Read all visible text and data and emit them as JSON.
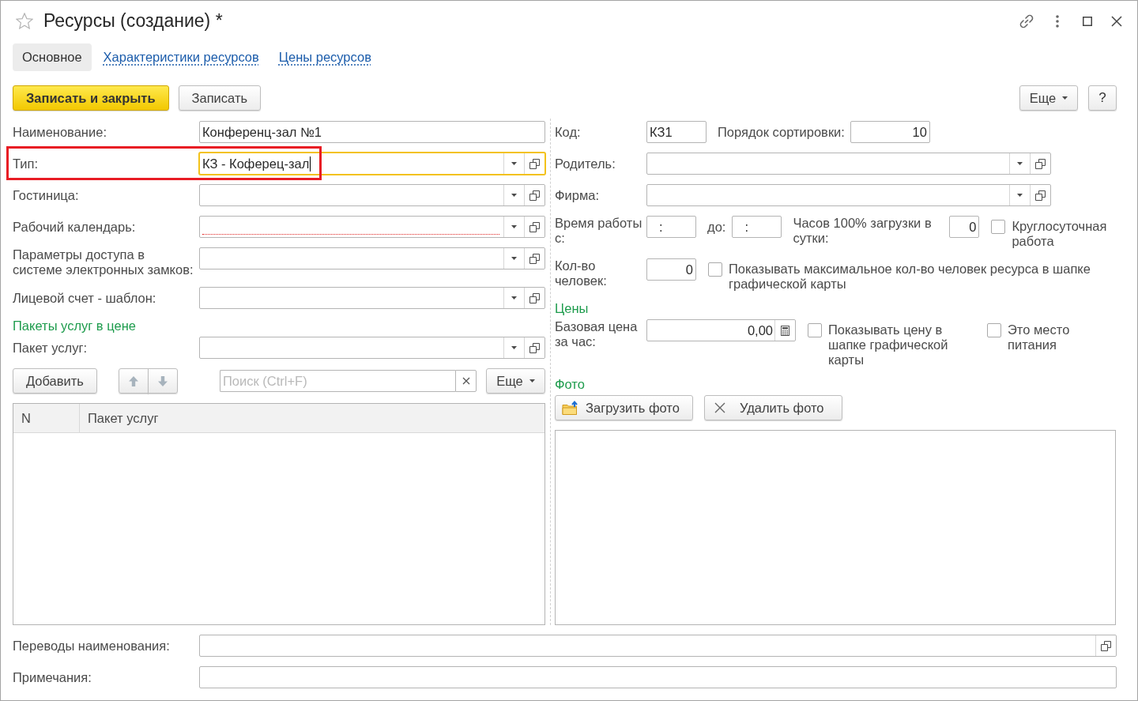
{
  "window": {
    "title": "Ресурсы (создание) *",
    "favorite": false
  },
  "tabs": [
    {
      "label": "Основное",
      "selected": true
    },
    {
      "label": "Характеристики ресурсов",
      "selected": false
    },
    {
      "label": "Цены ресурсов",
      "selected": false
    }
  ],
  "command_bar": {
    "buttons": [
      {
        "label": "Записать и закрыть",
        "kind": "primary"
      },
      {
        "label": "Записать",
        "kind": "normal"
      }
    ],
    "more": "Еще",
    "help": "?"
  },
  "left_fields": [
    {
      "kind": "text",
      "label": "Наименование:",
      "value": "Конференц-зал №1",
      "focused": false,
      "error": false,
      "highlighted": false
    },
    {
      "kind": "choice",
      "label": "Тип:",
      "value": "КЗ - Коферец-зал",
      "focused": true,
      "error": false,
      "highlighted": true
    },
    {
      "kind": "choice",
      "label": "Гостиница:",
      "focused": false,
      "error": false,
      "highlighted": false
    },
    {
      "kind": "choice",
      "label": "Рабочий календарь:",
      "focused": false,
      "error": true,
      "highlighted": false
    },
    {
      "kind": "choice",
      "label": "Параметры доступа в системе электронных замков:",
      "focused": false,
      "error": false,
      "highlighted": false
    },
    {
      "kind": "choice",
      "label": "Лицевой счет - шаблон:",
      "focused": false,
      "error": false,
      "highlighted": false
    }
  ],
  "packages": {
    "title": "Пакеты услуг в цене",
    "field": {
      "kind": "choice",
      "label": "Пакет услуг:",
      "focused": false,
      "error": false,
      "highlighted": false
    },
    "toolbar": {
      "add": "Добавить",
      "move_buttons": [
        {
          "kind": "up",
          "disabled": true
        },
        {
          "kind": "down",
          "disabled": true
        }
      ],
      "search": {
        "placeholder": "Поиск (Ctrl+F)"
      },
      "more": "Еще"
    },
    "table": {
      "columns": [
        "N",
        "Пакет услуг"
      ]
    }
  },
  "right": {
    "code": {
      "label": "Код:",
      "value": "КЗ1"
    },
    "sort_order": {
      "label": "Порядок сортировки:",
      "value": "10"
    },
    "choice_fields": [
      {
        "kind": "choice",
        "label": "Родитель:",
        "focused": false,
        "error": false,
        "highlighted": false
      },
      {
        "kind": "choice",
        "label": "Фирма:",
        "focused": false,
        "error": false,
        "highlighted": false
      }
    ],
    "work_time": {
      "label": "Время работы с:",
      "from": ":",
      "to_label": "до:",
      "to": ":"
    },
    "full_load_hours": {
      "label": "Часов 100% загрузки в сутки:",
      "value": "0"
    },
    "round_the_clock": {
      "label": "Круглосуточная работа",
      "checked": false
    },
    "people": {
      "label": "Кол-во человек:",
      "value": "0"
    },
    "show_max_people": {
      "label": "Показывать максимальное кол-во человек ресурса в шапке графической карты",
      "checked": false
    }
  },
  "prices": {
    "title": "Цены",
    "base_price": {
      "label": "Базовая цена за час:",
      "value": "0,00"
    },
    "checkboxes": [
      {
        "label": "Показывать цену в шапке графической карты",
        "checked": false
      },
      {
        "label": "Это место питания",
        "checked": false
      }
    ]
  },
  "photo": {
    "title": "Фото",
    "buttons": [
      {
        "kind": "upload",
        "label": "Загрузить фото"
      },
      {
        "kind": "delete",
        "label": "Удалить фото"
      }
    ]
  },
  "bottom_fields": [
    {
      "kind": "open",
      "label": "Переводы наименования:",
      "focused": false,
      "error": false,
      "highlighted": false
    },
    {
      "kind": "text",
      "label": "Примечания:",
      "focused": false,
      "error": false,
      "highlighted": false
    }
  ]
}
